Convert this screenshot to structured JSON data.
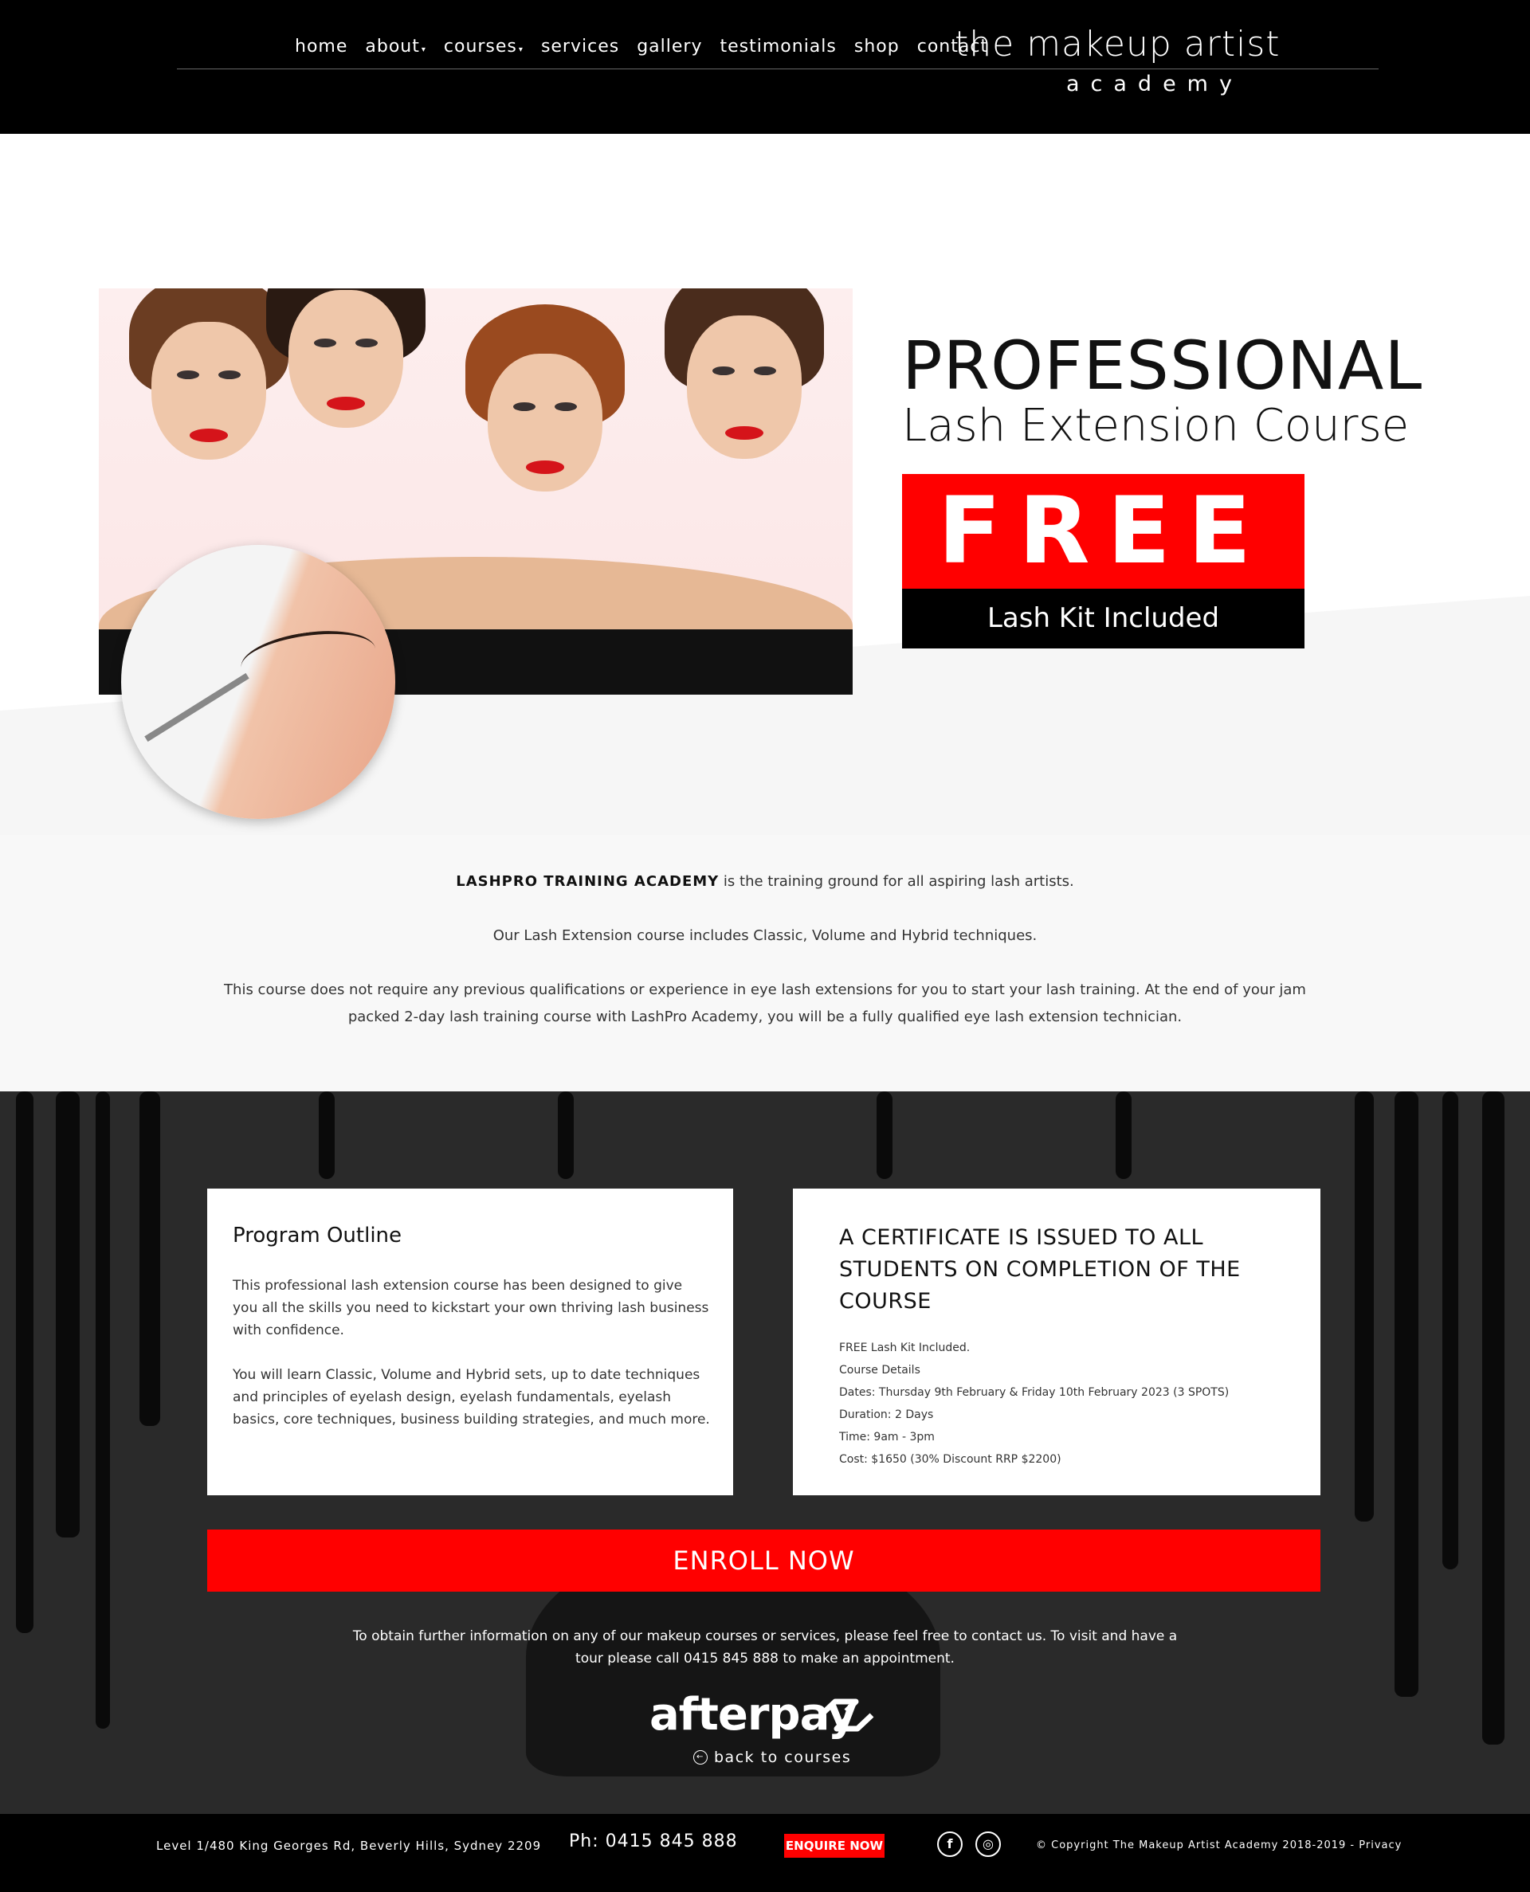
{
  "header": {
    "nav": [
      {
        "label": "home",
        "caret": false
      },
      {
        "label": "about",
        "caret": true
      },
      {
        "label": "courses",
        "caret": true
      },
      {
        "label": "services",
        "caret": false
      },
      {
        "label": "gallery",
        "caret": false
      },
      {
        "label": "testimonials",
        "caret": false
      },
      {
        "label": "shop",
        "caret": false
      },
      {
        "label": "contact",
        "caret": false
      }
    ],
    "logo_line1": "the makeup artist",
    "logo_line2": "academy"
  },
  "hero": {
    "title1": "PROFESSIONAL",
    "title2": "Lash Extension Course",
    "free_label": "FREE",
    "kit_label": "Lash Kit Included"
  },
  "intro": {
    "p1_strong": "LASHPRO TRAINING ACADEMY",
    "p1_rest": " is the training ground for all aspiring lash artists.",
    "p2": "Our Lash Extension course includes Classic, Volume and Hybrid techniques.",
    "p3": "This course does not require any previous qualifications or experience in eye lash extensions for you to start your lash training. At the end of your jam packed 2-day lash training course with LashPro Academy, you will be a fully qualified eye lash extension technician."
  },
  "program": {
    "title": "Program Outline",
    "p1": "This professional lash extension course has been designed to give you all the skills you need to kickstart your own thriving lash business with confidence.",
    "p2": "You will learn Classic, Volume and Hybrid sets, up to date techniques and principles of eyelash design, eyelash fundamentals, eyelash basics, core techniques, business building strategies, and much more."
  },
  "certificate": {
    "title": "A CERTIFICATE IS ISSUED TO ALL STUDENTS ON COMPLETION OF THE COURSE",
    "lines": [
      "FREE Lash Kit Included.",
      "Course Details",
      "Dates: Thursday 9th February & Friday 10th February 2023 (3 SPOTS)",
      "Duration: 2 Days",
      "Time: 9am - 3pm",
      "Cost: $1650 (30% Discount RRP $2200)"
    ]
  },
  "enroll_label": "ENROLL NOW",
  "contact_note": "To obtain further information on any of our makeup courses or services, please feel free to contact us. To visit and have a tour please call 0415 845 888 to make an appointment.",
  "afterpay_label": "afterpay",
  "back_label": "back to courses",
  "footer": {
    "address": "Level 1/480 King Georges Rd, Beverly Hills, Sydney 2209",
    "phone": "Ph: 0415 845 888",
    "enquire": "ENQUIRE NOW",
    "facebook_glyph": "f",
    "instagram_glyph": "◎",
    "copyright": "© Copyright The Makeup Artist Academy 2018-2019 - Privacy"
  },
  "colors": {
    "accent": "#ff0000",
    "header_bg": "#000000",
    "section_dark": "#2a2a2a"
  }
}
